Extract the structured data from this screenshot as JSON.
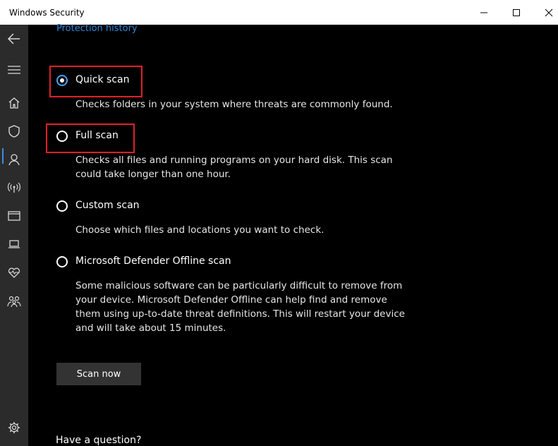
{
  "window": {
    "title": "Windows Security"
  },
  "sidebar": {
    "icons": [
      "back-arrow-icon",
      "hamburger-menu-icon",
      "home-icon",
      "shield-icon",
      "person-icon",
      "wireless-icon",
      "browser-window-icon",
      "laptop-icon",
      "heart-pulse-icon",
      "family-icon",
      "gear-icon"
    ],
    "active_item": "shield-icon",
    "active_color": "#3a8fe0"
  },
  "main": {
    "protection_history_link": "Protection history",
    "options": [
      {
        "label": "Quick scan",
        "description": "Checks folders in your system where threats are commonly found.",
        "selected": true
      },
      {
        "label": "Full scan",
        "description": "Checks all files and running programs on your hard disk. This scan could take longer than one hour.",
        "selected": false
      },
      {
        "label": "Custom scan",
        "description": "Choose which files and locations you want to check.",
        "selected": false
      },
      {
        "label": "Microsoft Defender Offline scan",
        "description": "Some malicious software can be particularly difficult to remove from your device. Microsoft Defender Offline can help find and remove them using up-to-date threat definitions. This will restart your device and will take about 15 minutes.",
        "selected": false
      }
    ],
    "scan_now_label": "Scan now",
    "question_heading": "Have a question?"
  },
  "colors": {
    "background": "#000000",
    "sidebar": "#2b2b2b",
    "link": "#2f86d7",
    "highlight": "#e0202a",
    "button": "#333333"
  }
}
